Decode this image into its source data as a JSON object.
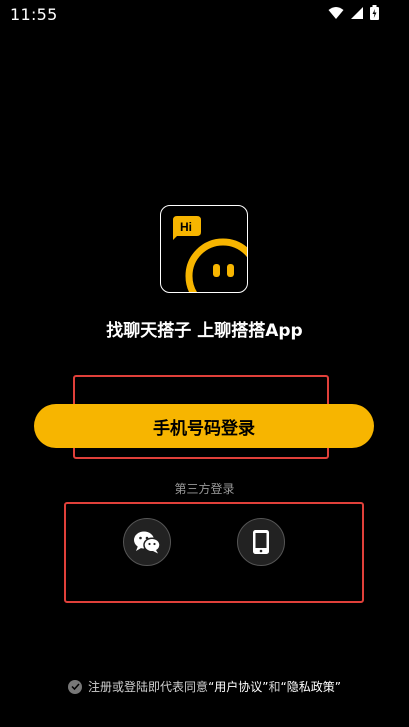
{
  "status_bar": {
    "time": "11:55",
    "icons": [
      "wifi-icon",
      "signal-icon",
      "battery-icon"
    ]
  },
  "app": {
    "logo_badge": "Hi",
    "tagline": "找聊天搭子  上聊搭搭App",
    "accent_color": "#F7B500"
  },
  "login": {
    "phone_button_label": "手机号码登录",
    "third_party_label": "第三方登录",
    "third_party_options": [
      "wechat-icon",
      "mobile-icon"
    ]
  },
  "agreement": {
    "prefix": "注册或登陆即代表同意",
    "user_agreement": "“用户协议”",
    "and": "和",
    "privacy_policy": "“隐私政策”"
  },
  "highlight_color": "#E0403A"
}
